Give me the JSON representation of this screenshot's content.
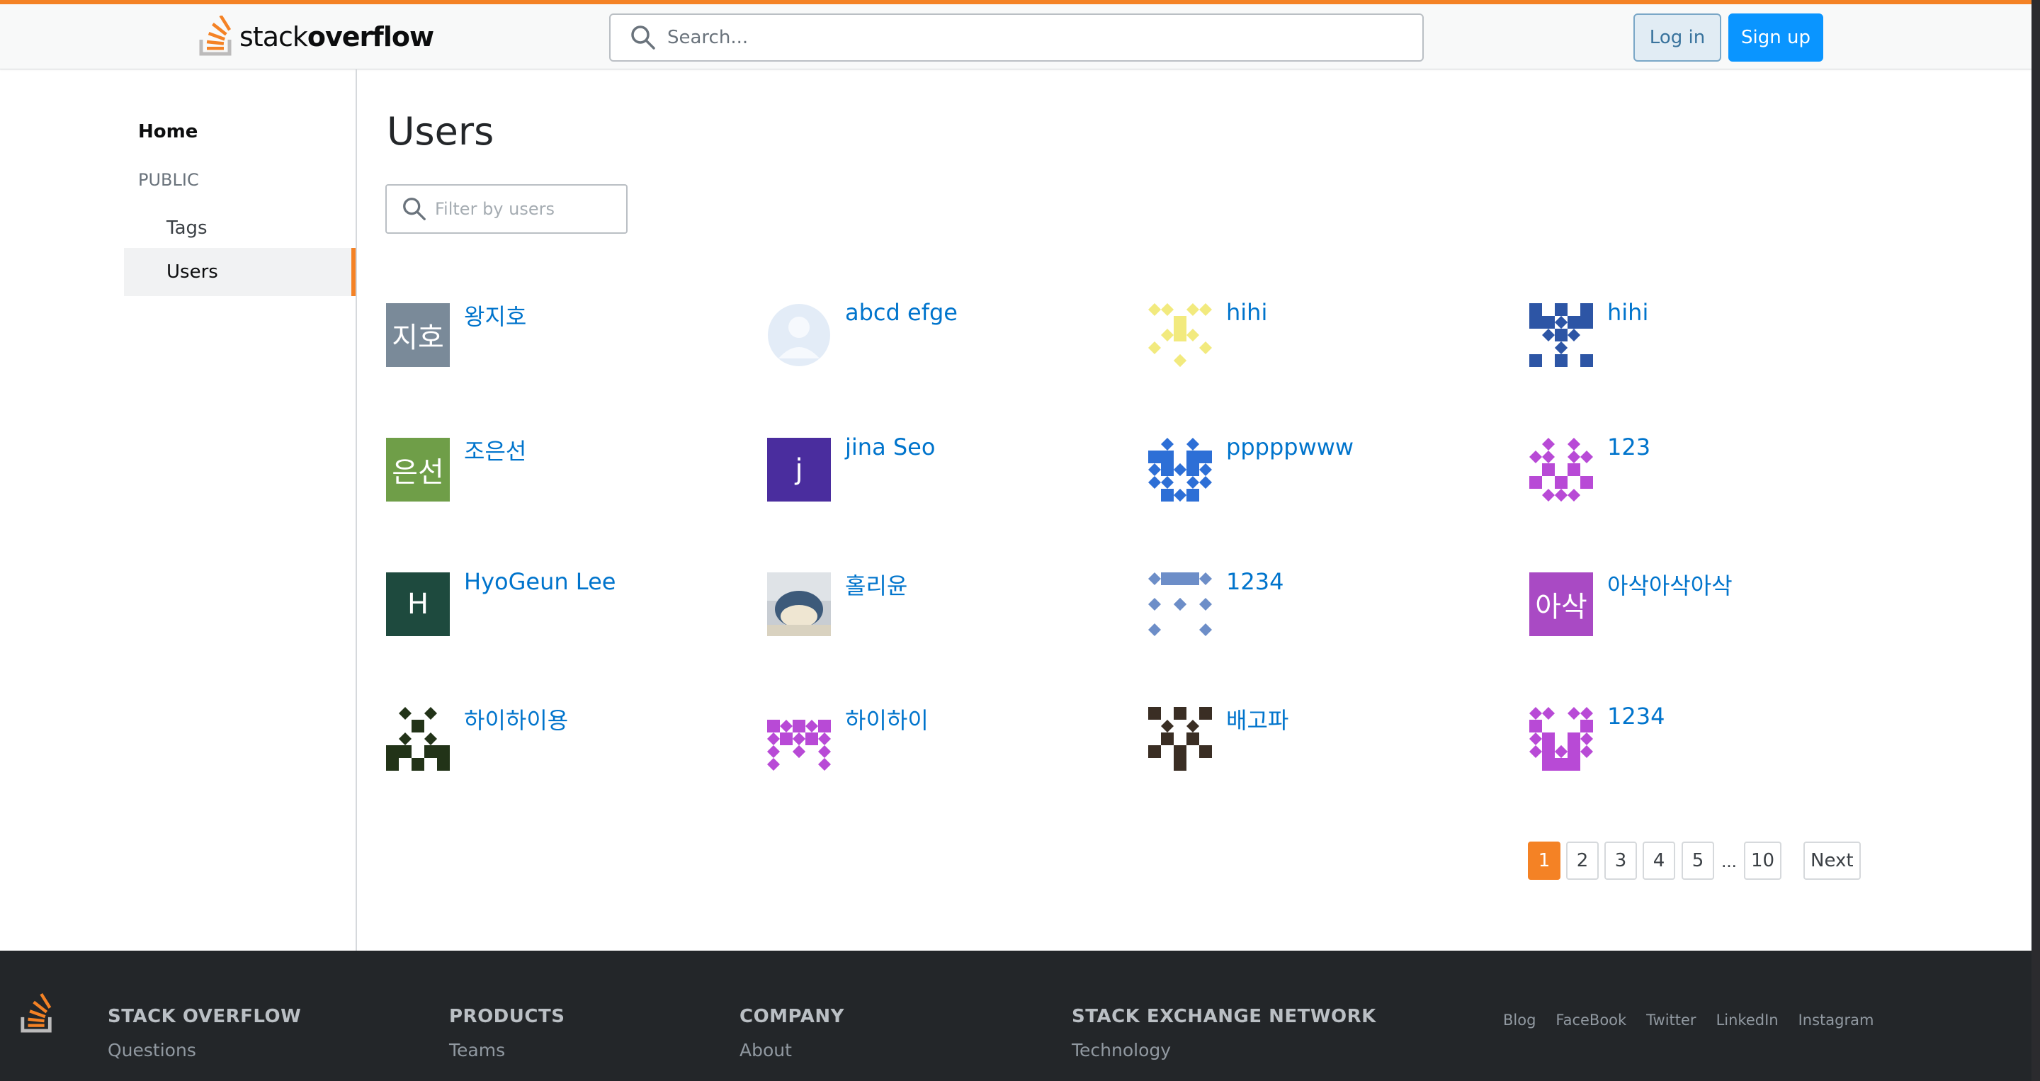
{
  "header": {
    "logo_text_light": "stack",
    "logo_text_bold": "overflow",
    "search_placeholder": "Search...",
    "login_label": "Log in",
    "signup_label": "Sign up",
    "accent_color": "#f48225",
    "link_color": "#0074cc"
  },
  "sidebar": {
    "items": [
      {
        "label": "Home"
      },
      {
        "label": "PUBLIC"
      },
      {
        "label": "Tags"
      },
      {
        "label": "Users"
      }
    ]
  },
  "main": {
    "title": "Users",
    "filter_placeholder": "Filter by users",
    "users": [
      {
        "name": "왕지호",
        "avatar_text": "지호",
        "avatar_kind": "initials",
        "avatar_color": "#7a8a99"
      },
      {
        "name": "abcd efge",
        "avatar_kind": "default-person",
        "avatar_color": "#e3ecf7"
      },
      {
        "name": "hihi",
        "avatar_kind": "identicon",
        "avatar_color": "#f2ea7e"
      },
      {
        "name": "hihi",
        "avatar_kind": "identicon",
        "avatar_color": "#2d55a5"
      },
      {
        "name": "조은선",
        "avatar_text": "은선",
        "avatar_kind": "initials",
        "avatar_color": "#6f9e48"
      },
      {
        "name": "jina Seo",
        "avatar_text": "j",
        "avatar_kind": "initials",
        "avatar_color": "#4a2d9e"
      },
      {
        "name": "pppppwww",
        "avatar_kind": "identicon",
        "avatar_color": "#2d6fd6"
      },
      {
        "name": "123",
        "avatar_kind": "identicon",
        "avatar_color": "#b84ad6"
      },
      {
        "name": "HyoGeun Lee",
        "avatar_text": "H",
        "avatar_kind": "initials",
        "avatar_color": "#1e4a3e"
      },
      {
        "name": "홀리윤",
        "avatar_kind": "photo",
        "avatar_color": "#c8cdd3"
      },
      {
        "name": "1234",
        "avatar_kind": "identicon",
        "avatar_color": "#6d8ec8"
      },
      {
        "name": "아삭아삭아삭",
        "avatar_text": "아삭",
        "avatar_kind": "initials",
        "avatar_color": "#a94ac4"
      },
      {
        "name": "하이하이용",
        "avatar_kind": "identicon",
        "avatar_color": "#223318"
      },
      {
        "name": "하이하이",
        "avatar_kind": "identicon",
        "avatar_color": "#b84ad6"
      },
      {
        "name": "배고파",
        "avatar_kind": "identicon",
        "avatar_color": "#3a2e24"
      },
      {
        "name": "1234",
        "avatar_kind": "identicon",
        "avatar_color": "#b84ad6"
      }
    ]
  },
  "pagination": {
    "pages": [
      "1",
      "2",
      "3",
      "4",
      "5"
    ],
    "ellipsis": "...",
    "last_page": "10",
    "next_label": "Next",
    "current": "1"
  },
  "footer": {
    "columns": [
      {
        "heading": "STACK OVERFLOW",
        "link": "Questions"
      },
      {
        "heading": "PRODUCTS",
        "link": "Teams"
      },
      {
        "heading": "COMPANY",
        "link": "About"
      },
      {
        "heading": "STACK EXCHANGE NETWORK",
        "link": "Technology"
      }
    ],
    "social": [
      "Blog",
      "FaceBook",
      "Twitter",
      "LinkedIn",
      "Instagram"
    ]
  }
}
